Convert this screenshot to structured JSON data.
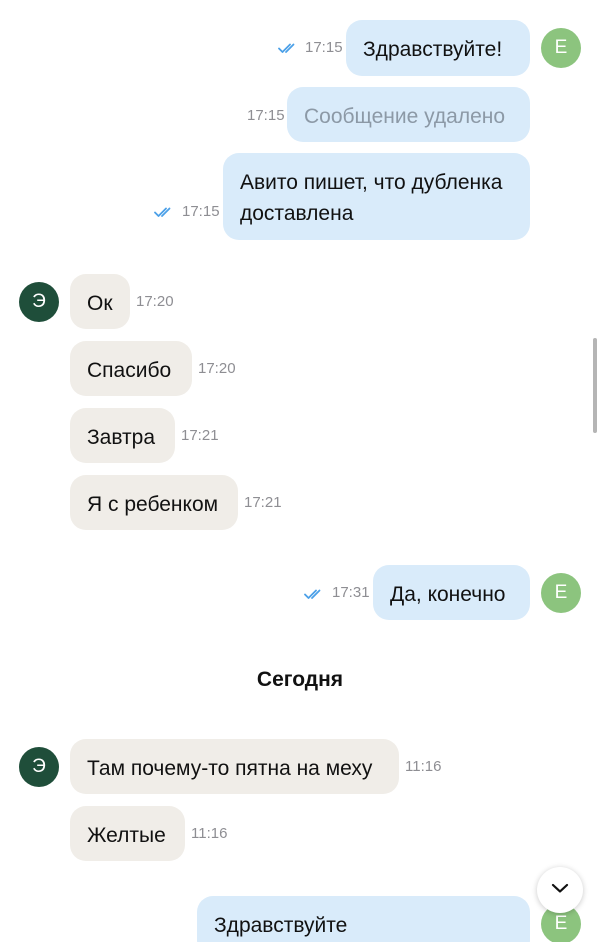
{
  "avatars": {
    "me": "Е",
    "peer": "Э"
  },
  "messages": [
    {
      "direction": "out",
      "text": "Здравствуйте!",
      "time": "17:15",
      "status": "read"
    },
    {
      "direction": "out",
      "text": "Сообщение удалено",
      "time": "17:15",
      "status": "deleted"
    },
    {
      "direction": "out",
      "lines": [
        "Авито пишет, что дубленка",
        "доставлена"
      ],
      "time": "17:15",
      "status": "read"
    },
    {
      "direction": "in",
      "text": "Ок",
      "time": "17:20"
    },
    {
      "direction": "in",
      "text": "Спасибо",
      "time": "17:20"
    },
    {
      "direction": "in",
      "text": "Завтра",
      "time": "17:21"
    },
    {
      "direction": "in",
      "text": "Я с ребенком",
      "time": "17:21"
    },
    {
      "direction": "out",
      "text": "Да, конечно",
      "time": "17:31",
      "status": "read"
    },
    {
      "direction": "in",
      "text": "Там почему-то пятна на меху",
      "time": "11:16"
    },
    {
      "direction": "in",
      "text": "Желтые",
      "time": "11:16"
    },
    {
      "direction": "out",
      "text": "Здравствуйте"
    }
  ],
  "date_separator": "Сегодня",
  "icons": {
    "read_ticks": "double-check-icon",
    "scroll_down": "chevron-down-icon"
  },
  "colors": {
    "outgoing_bubble": "#d9ebfa",
    "incoming_bubble": "#f0ede8",
    "read_ticks": "#4ba0e8",
    "my_avatar": "#8cc47e",
    "peer_avatar": "#1f4e3a"
  }
}
